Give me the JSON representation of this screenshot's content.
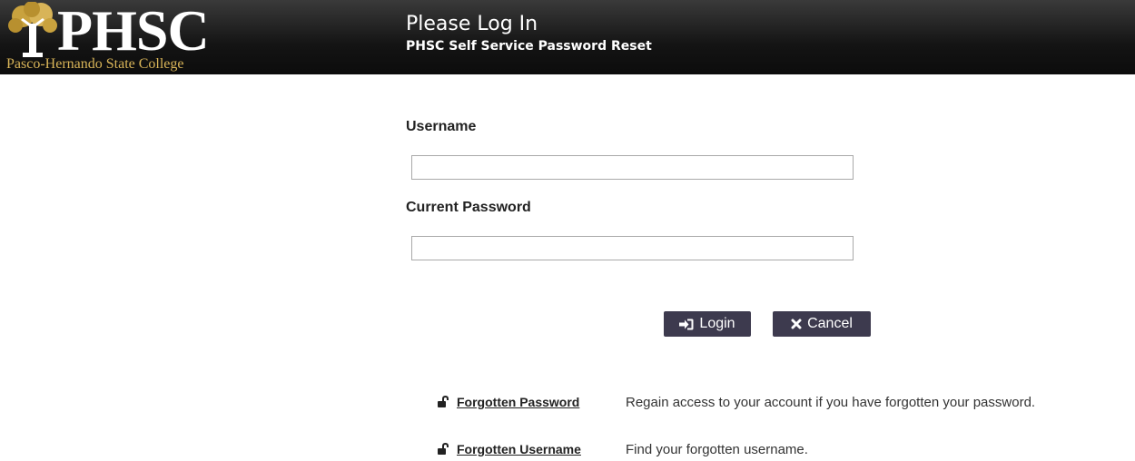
{
  "header": {
    "logo_text": "PHSC",
    "logo_subtitle": "Pasco-Hernando State College",
    "title": "Please Log In",
    "subtitle": "PHSC Self Service Password Reset"
  },
  "form": {
    "username_label": "Username",
    "username_value": "",
    "password_label": "Current Password",
    "password_value": ""
  },
  "buttons": {
    "login_label": "Login",
    "cancel_label": "Cancel"
  },
  "help": [
    {
      "link": "Forgotten Password",
      "description": "Regain access to your account if you have forgotten your password."
    },
    {
      "link": "Forgotten Username",
      "description": "Find your forgotten username."
    }
  ],
  "colors": {
    "header_bg": "#141414",
    "logo_gold": "#d8b458",
    "button_bg": "#3d3a4e"
  },
  "icons": {
    "logo": "tree-icon",
    "login": "sign-in-icon",
    "cancel": "close-icon",
    "help": "unlock-icon"
  }
}
